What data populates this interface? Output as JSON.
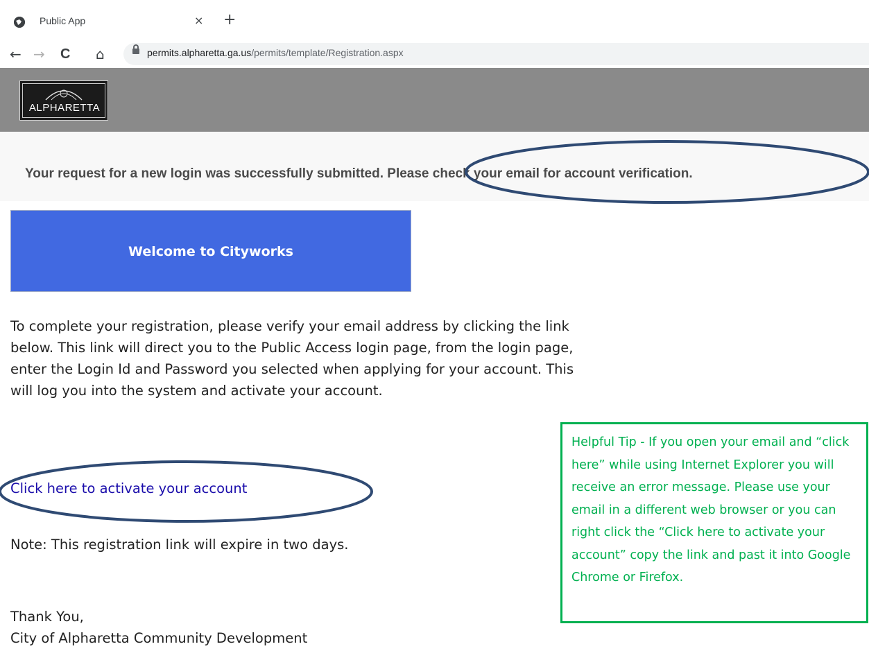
{
  "browser": {
    "tab_title": "Public App",
    "tab_close": "×",
    "new_tab": "+",
    "back": "←",
    "forward": "→",
    "reload": "C",
    "home": "⌂",
    "url_host": "permits.alpharetta.ga.us",
    "url_path": "/permits/template/Registration.aspx"
  },
  "header": {
    "logo_text": "ALPHARETTA"
  },
  "banner": {
    "message": "Your request for a new login was successfully submitted. Please check your email for account verification."
  },
  "email": {
    "welcome": "Welcome to Cityworks",
    "body": "To complete your registration, please verify your email address by clicking the link below. This link will direct you to the Public Access login page, from the login page, enter the Login Id and Password you selected when applying for your account. This will log you into the system and activate your account.",
    "link": "Click here to activate your account",
    "note": "Note: This registration link will expire in two days.",
    "thanks": "Thank You,",
    "signature": "City of Alpharetta Community Development"
  },
  "tip": {
    "text": "Helpful Tip - If you open your email and “click here” while using Internet Explorer you will receive an error message.  Please use your email in a different web browser or you can right click the “Click here to activate your account” copy the link and past it into Google Chrome or Firefox."
  },
  "colors": {
    "header_gray": "#8a8a8a",
    "welcome_blue": "#4169e1",
    "link_blue": "#1a0dab",
    "tip_green": "#00b050",
    "annotation_navy": "#2f4a73"
  },
  "icons": [
    "globe-icon",
    "close-icon",
    "plus-icon",
    "back-arrow-icon",
    "forward-arrow-icon",
    "reload-icon",
    "home-icon",
    "lock-icon"
  ]
}
